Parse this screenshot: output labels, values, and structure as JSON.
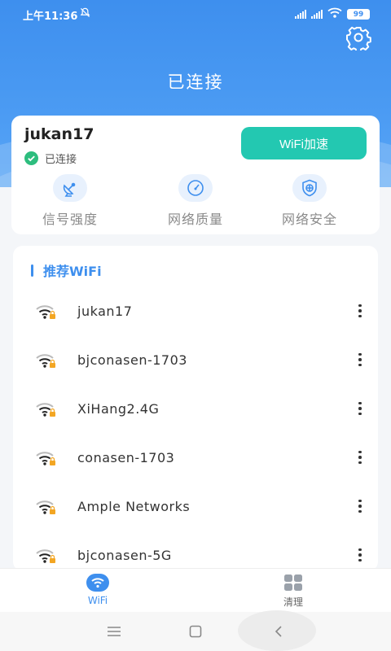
{
  "status_bar": {
    "time": "上午11:36",
    "battery": "99"
  },
  "header": {
    "title": "已连接"
  },
  "current": {
    "ssid": "jukan17",
    "status": "已连接",
    "accelerate_label": "WiFi加速",
    "features": [
      {
        "label": "信号强度",
        "icon": "satellite-dish-icon"
      },
      {
        "label": "网络质量",
        "icon": "speedometer-icon"
      },
      {
        "label": "网络安全",
        "icon": "shield-icon"
      }
    ]
  },
  "recommended": {
    "title": "推荐WiFi",
    "networks": [
      {
        "name": "jukan17"
      },
      {
        "name": "bjconasen-1703"
      },
      {
        "name": "XiHang2.4G"
      },
      {
        "name": "conasen-1703"
      },
      {
        "name": "Ample Networks"
      },
      {
        "name": "bjconasen-5G"
      }
    ]
  },
  "tabs": [
    {
      "label": "WiFi",
      "icon": "wifi-icon",
      "active": true
    },
    {
      "label": "清理",
      "icon": "grid-icon",
      "active": false
    }
  ],
  "colors": {
    "accent": "#3e8fee",
    "button": "#23c8b1",
    "success": "#2dbd7e",
    "lock": "#f3a623"
  }
}
